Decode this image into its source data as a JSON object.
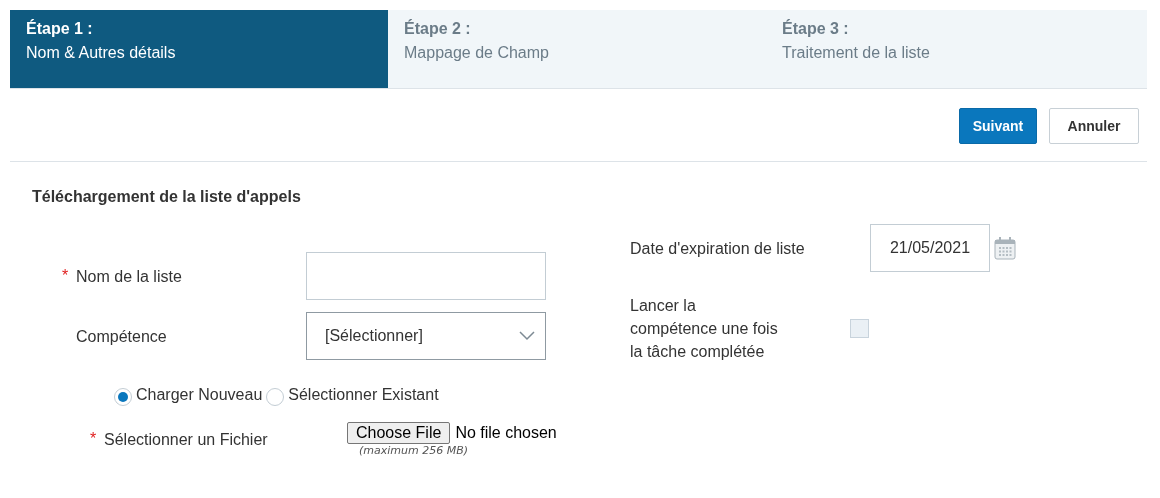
{
  "steps": [
    {
      "number": "Étape 1 :",
      "name": "Nom & Autres détails",
      "selected": true
    },
    {
      "number": "Étape 2 :",
      "name": "Mappage de Champ",
      "selected": false
    },
    {
      "number": "Étape 3 :",
      "name": "Traitement de la liste",
      "selected": false
    }
  ],
  "buttons": [
    {
      "label": "Suivant",
      "kind": "primary"
    },
    {
      "label": "Annuler",
      "kind": "secondary"
    }
  ],
  "section_title": "Téléchargement de la liste d'appels",
  "list_name": {
    "label": "Nom de la liste",
    "required_mark": "*"
  },
  "competence": {
    "label": "Compétence",
    "value": "[Sélectionner]"
  },
  "source_options": [
    {
      "label": "Charger Nouveau",
      "selected": true
    },
    {
      "label": "Sélectionner Existant",
      "selected": false
    }
  ],
  "file": {
    "label": "Sélectionner un Fichier",
    "required_mark": "*",
    "button": "Choose File",
    "status": "No file chosen",
    "hint": "(maximum 256 MB)"
  },
  "expiration": {
    "label": "Date d'expiration de liste",
    "value": "21/05/2021"
  },
  "launch": {
    "label": "Lancer la compétence une fois la tâche complétée",
    "checked": false
  }
}
